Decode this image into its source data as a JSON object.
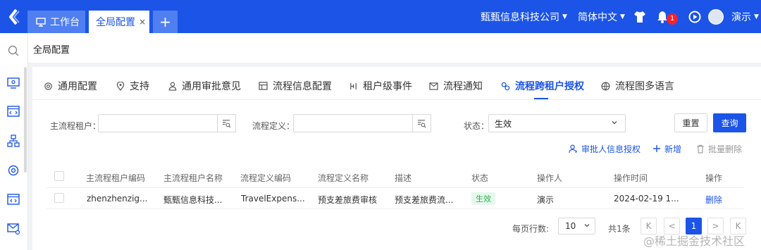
{
  "topbar": {
    "tabs": [
      {
        "label": "工作台"
      },
      {
        "label": "全局配置",
        "close": "×"
      },
      {
        "label": "+"
      }
    ],
    "company": "甄甄信息科技公司",
    "language": "简体中文",
    "notification_count": "1",
    "user": "演示",
    "accent_color": "#1b54e6"
  },
  "breadcrumb": "全局配置",
  "content_tabs": [
    {
      "label": "通用配置",
      "icon": "gear-icon"
    },
    {
      "label": "支持",
      "icon": "location-icon"
    },
    {
      "label": "通用审批意见",
      "icon": "user-icon"
    },
    {
      "label": "流程信息配置",
      "icon": "table-icon"
    },
    {
      "label": "租户级事件",
      "icon": "flow-icon"
    },
    {
      "label": "流程通知",
      "icon": "mail-icon"
    },
    {
      "label": "流程跨租户授权",
      "icon": "link-icon",
      "active": true
    },
    {
      "label": "流程图多语言",
      "icon": "globe-icon"
    }
  ],
  "filters": {
    "main_tenant_label": "主流程租户：",
    "main_tenant_value": "",
    "process_def_label": "流程定义：",
    "process_def_value": "",
    "status_label": "状态：",
    "status_value": "生效",
    "reset": "重置",
    "query": "查询"
  },
  "actions": {
    "approver_auth": "审批人信息授权",
    "add": "新增",
    "batch_delete": "批量删除"
  },
  "table": {
    "columns": [
      "主流程租户编码",
      "主流程租户名称",
      "流程定义编码",
      "流程定义名称",
      "描述",
      "状态",
      "操作人",
      "操作时间",
      "操作"
    ],
    "rows": [
      {
        "tenant_code": "zhenzhenzig...",
        "tenant_name": "甄甄信息科技...",
        "def_code": "TravelExpens...",
        "def_name": "预支差旅费审核",
        "desc": "预支差旅费流...",
        "status": "生效",
        "operator": "演示",
        "time": "2024-02-19 1...",
        "op": "删除"
      }
    ]
  },
  "pagination": {
    "page_size_label": "每页行数:",
    "page_size": "10",
    "total": "共1条",
    "first": "K",
    "prev": "<",
    "current": "1",
    "next": ">",
    "last": "K"
  },
  "watermark": "@稀土掘金技术社区"
}
